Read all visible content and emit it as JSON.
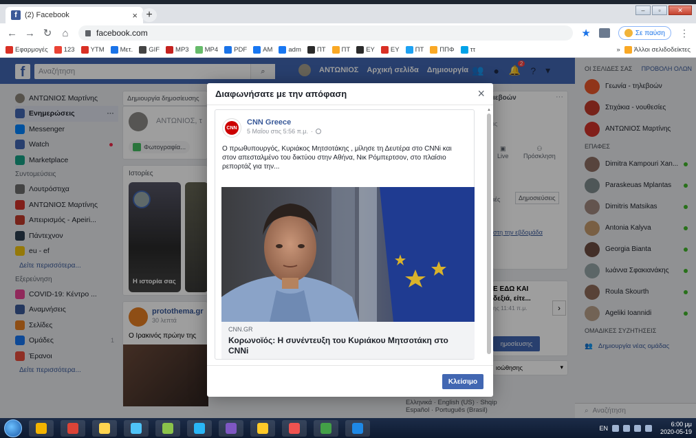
{
  "browser": {
    "tab_title": "(2) Facebook",
    "tab_close": "×",
    "new_tab": "+",
    "url": "facebook.com",
    "pause_label": "Σε παύση",
    "top_clock": "2020-05-19",
    "bookmarks": [
      "Εφαρμογές",
      "123",
      "YTM",
      "Μετ.",
      "GIF",
      "MP3",
      "MP4",
      "PDF",
      "AM",
      "adm",
      "ΠΤ",
      "ΠΤ",
      "ΕΥ",
      "ΕΥ",
      "ΠΤ",
      "ΠΠΦ",
      "ττ"
    ],
    "bookmarks_more": "»",
    "other_bookmarks": "Άλλοι σελιδοδείκτες",
    "colors": {
      "bookmark_icons": [
        "#d93025",
        "#ea4335",
        "#d93025",
        "#1a73e8",
        "#444444",
        "#c5221f",
        "#66bb6a",
        "#1a73e8",
        "#1877f2",
        "#1877f2",
        "#2b2b2b",
        "#f9a825",
        "#2b2b2b",
        "#d93025",
        "#1da1f2",
        "#f9a825",
        "#00a2e8",
        "#f9a825"
      ]
    }
  },
  "facebook": {
    "search_placeholder": "Αναζήτηση",
    "user_name": "ΑΝΤΩΝΙΟΣ",
    "nav_home": "Αρχική σελίδα",
    "nav_create": "Δημιουργία",
    "notif_count": "2",
    "left_user": "ΑΝΤΩΝΙΟΣ Μαρτίνης",
    "left_items": [
      {
        "label": "Ενημερώσεις",
        "color": "#4267b2"
      },
      {
        "label": "Messenger",
        "color": "#0084ff"
      },
      {
        "label": "Watch",
        "color": "#4267b2"
      },
      {
        "label": "Marketplace",
        "color": "#16a085"
      }
    ],
    "section_shortcuts": "Συντομεύσεις",
    "shortcuts": [
      {
        "label": "Λουτρόστιχα",
        "color": "#6d6d6d"
      },
      {
        "label": "ΑΝΤΩΝΙΟΣ Μαρτίνης",
        "color": "#d0322b"
      },
      {
        "label": "Απειρισμός - Apeiri...",
        "color": "#c0392b"
      },
      {
        "label": "Πάντεχνον",
        "color": "#2c3e50"
      },
      {
        "label": "eu - ef",
        "color": "#f1c40f"
      }
    ],
    "see_more": "Δείτε περισσότερα...",
    "section_explore": "Εξερεύνηση",
    "explore": [
      {
        "label": "COVID-19: Κέντρο ...",
        "color": "#e84393"
      },
      {
        "label": "Αναμνήσεις",
        "color": "#3b5998"
      },
      {
        "label": "Σελίδες",
        "color": "#e67e22"
      },
      {
        "label": "Ομάδες",
        "color": "#1877f2"
      },
      {
        "label": "Έρανοι",
        "color": "#e74c3c"
      }
    ],
    "explore_count": "1",
    "see_more_2": "Δείτε περισσότερα...",
    "create_post": "Δημιουργία δημοσίευσης",
    "composer_name": "ΑΝΤΩΝΙΟΣ, τ",
    "photo_label": "Φωτογραφία...",
    "stories": "Ιστορίες",
    "story_label": "Η ιστορία σας",
    "feed_page": "protothema.gr",
    "feed_time": "30 λεπτά",
    "feed_text": "Ο Ιρακινός πρώην της",
    "mid_fragments": {
      "f1": "ιεβοών",
      "f2": "ις",
      "f3": "Live",
      "f4": "Πρόσκληση",
      "f5": "ιές",
      "f6": "Δημοσιεύσεις",
      "f7": "στη την εβδομάδα",
      "f8": "Ε ΕΔΩ ΚΑΙ",
      "f9": "δεξιά, είτε...",
      "f10": "ης 11:41 π.μ.",
      "f11": "ημοσίευσης",
      "f12": "ιοώθησης",
      "f13": "···"
    },
    "right_header_groups": "ΟΙ ΣΕΛΙΔΕΣ ΣΑΣ",
    "right_header_view": "ΠΡΟΒΟΛΗ ΟΛΩΝ",
    "right_pages": [
      {
        "name": "Γεωνία - τηλεβοών",
        "color": "#e8562a"
      },
      {
        "name": "Στιχάκια - νουθεσίες",
        "color": "#c0392b"
      },
      {
        "name": "ΑΝΤΩΝΙΟΣ Μαρτίνης",
        "color": "#d0322b"
      }
    ],
    "contacts_header": "ΕΠΑΦΕΣ",
    "contacts": [
      {
        "name": "Dimitra Kampouri Xan...",
        "color": "#8d6e63"
      },
      {
        "name": "Paraskeuas Mplantas",
        "color": "#7f8c8d"
      },
      {
        "name": "Dimitris Matsikas",
        "color": "#a1887f"
      },
      {
        "name": "Antonia Kalyva",
        "color": "#c49a6c"
      },
      {
        "name": "Georgia Bianta",
        "color": "#6d4c41"
      },
      {
        "name": "Ιωάννα Σφακιανάκης",
        "color": "#95a5a6"
      },
      {
        "name": "Roula Skourth",
        "color": "#8e6b5a"
      },
      {
        "name": "Ageliki Ioannidi",
        "color": "#b8a08a"
      }
    ],
    "group_chats": "ΟΜΑΔΙΚΕΣ ΣΥΖΗΤΗΣΕΙΣ",
    "create_group": "Δημιουργία νέας ομάδας",
    "chat_search": "Αναζήτηση",
    "footer_langs": "Ελληνικά · English (US) · Shqip",
    "footer_langs2": "Español · Português (Brasil)"
  },
  "modal": {
    "title": "Διαφωνήσατε με την απόφαση",
    "close_x": "×",
    "post": {
      "page_name": "CNN Greece",
      "avatar_text": "CNN",
      "timestamp": "5 Μαΐου στις 5:56 π.μ.",
      "text": "Ο πρωθυπουργός, Κυριάκος Μητσοτάκης , μίλησε τη Δευτέρα στο CNNi και στον απεσταλμένο του δικτύου στην Αθήνα, Νικ Ρόμπερτσον, στο πλαίσιο ρεπορτάζ για την...",
      "link_domain": "CNN.GR",
      "link_headline": "Κορωνοϊός: Η συνέντευξη του Κυριάκου Μητσοτάκη στο CNNi"
    },
    "close_button": "Κλείσιμο"
  },
  "taskbar": {
    "lang": "EN",
    "time": "6:00 μμ",
    "date": "2020-05-19",
    "app_colors": [
      "#f4b400",
      "#db4437",
      "#ffd54f",
      "#4fc3f7",
      "#8bc34a",
      "#29b6f6",
      "#7e57c2",
      "#ffca28",
      "#ef5350",
      "#43a047",
      "#1e88e5"
    ]
  }
}
